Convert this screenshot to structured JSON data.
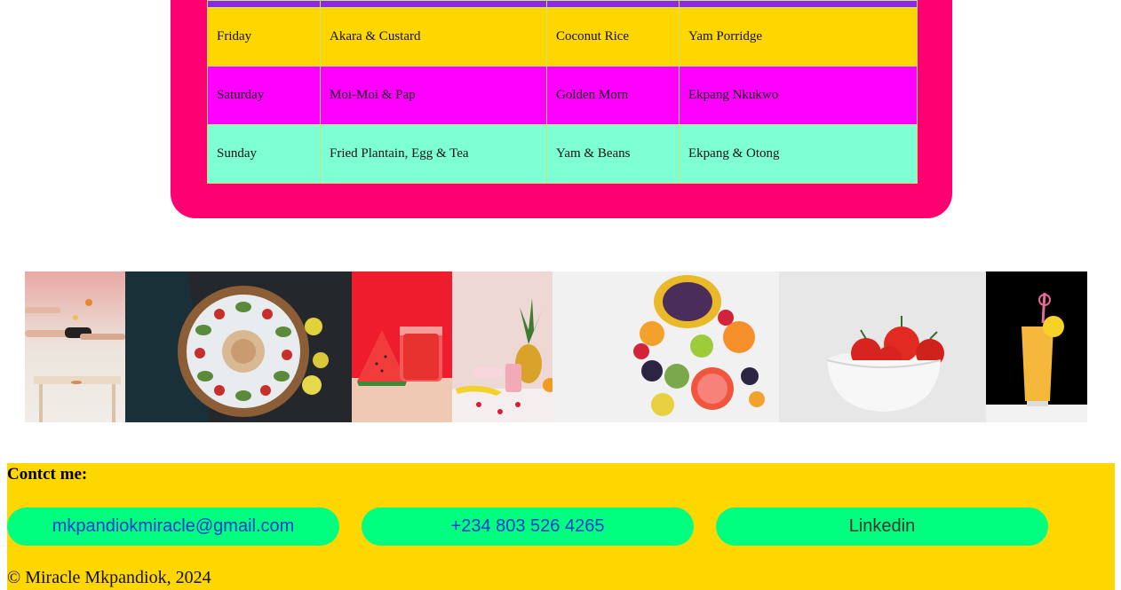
{
  "meal_table": {
    "rows": [
      [
        "Friday",
        "Akara & Custard",
        "Coconut Rice",
        "Yam Porridge"
      ],
      [
        "Saturday",
        "Moi-Moi & Pap",
        "Golden Morn",
        "Ekpang Nkukwo"
      ],
      [
        "Sunday",
        "Fried Plantain, Egg & Tea",
        "Yam & Beans",
        "Ekpang & Otong"
      ]
    ],
    "row_colors": [
      "#ffd700",
      "#ff00ff",
      "#7fffd4"
    ]
  },
  "gallery": {
    "images": [
      "cooking-pan-photo",
      "salad-plate-photo",
      "watermelon-juice-photo",
      "pineapple-smoothie-photo",
      "fruit-platter-photo",
      "tomato-bowl-photo",
      "orange-drink-photo"
    ]
  },
  "footer": {
    "heading": "Contct me:",
    "email": "mkpandiokmiracle@gmail.com",
    "phone": "+234 803 526 4265",
    "linkedin": "Linkedin",
    "copyright": "© Miracle Mkpandiok, 2024"
  },
  "colors": {
    "card": "#ff0073",
    "header_stub": "#8a2be2",
    "footer_bg": "#ffd700",
    "pill_bg": "#00ff7f",
    "link": "#0a3ad8"
  }
}
